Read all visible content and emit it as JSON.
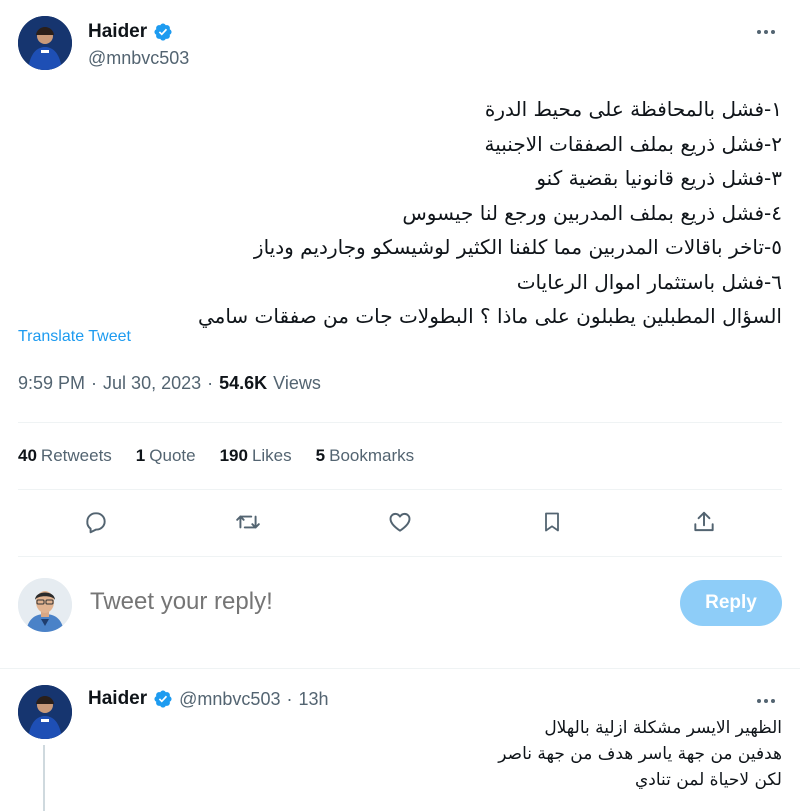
{
  "tweet": {
    "display_name": "Haider",
    "handle": "@mnbvc503",
    "lines": [
      "١-فشل بالمحافظة على محيط الدرة",
      "٢-فشل ذريع بملف الصفقات الاجنبية",
      "٣-فشل ذريع قانونيا بقضية كنو",
      "٤-فشل ذريع بملف المدربين ورجع لنا جيسوس",
      "٥-تاخر باقالات المدربين مما كلفنا الكثير لوشيسكو وجارديم ودياز",
      "٦-فشل باستثمار اموال الرعايات",
      "السؤال المطبلين يطبلون على ماذا ؟ البطولات جات من صفقات سامي"
    ],
    "translate_label": "Translate Tweet",
    "time": "9:59 PM",
    "date": "Jul 30, 2023",
    "separator": "·",
    "views_count": "54.6K",
    "views_label": "Views"
  },
  "stats": {
    "retweets_count": "40",
    "retweets_label": "Retweets",
    "quotes_count": "1",
    "quotes_label": "Quote",
    "likes_count": "190",
    "likes_label": "Likes",
    "bookmarks_count": "5",
    "bookmarks_label": "Bookmarks"
  },
  "actions": {
    "reply_icon": "reply-icon",
    "retweet_icon": "retweet-icon",
    "like_icon": "heart-icon",
    "bookmark_icon": "bookmark-icon",
    "share_icon": "share-icon"
  },
  "composer": {
    "placeholder": "Tweet your reply!",
    "button_label": "Reply"
  },
  "reply": {
    "display_name": "Haider",
    "handle": "@mnbvc503",
    "separator": "·",
    "age": "13h",
    "lines": [
      "الظهير الايسر مشكلة ازلية بالهلال",
      "هدفين من جهة ياسر هدف من جهة ناصر",
      "لكن لاحياة لمن تنادي"
    ]
  },
  "colors": {
    "accent": "#1d9bf0",
    "muted": "#536471",
    "reply_button_disabled": "#8ecdf8",
    "divider": "#eff3f4"
  }
}
